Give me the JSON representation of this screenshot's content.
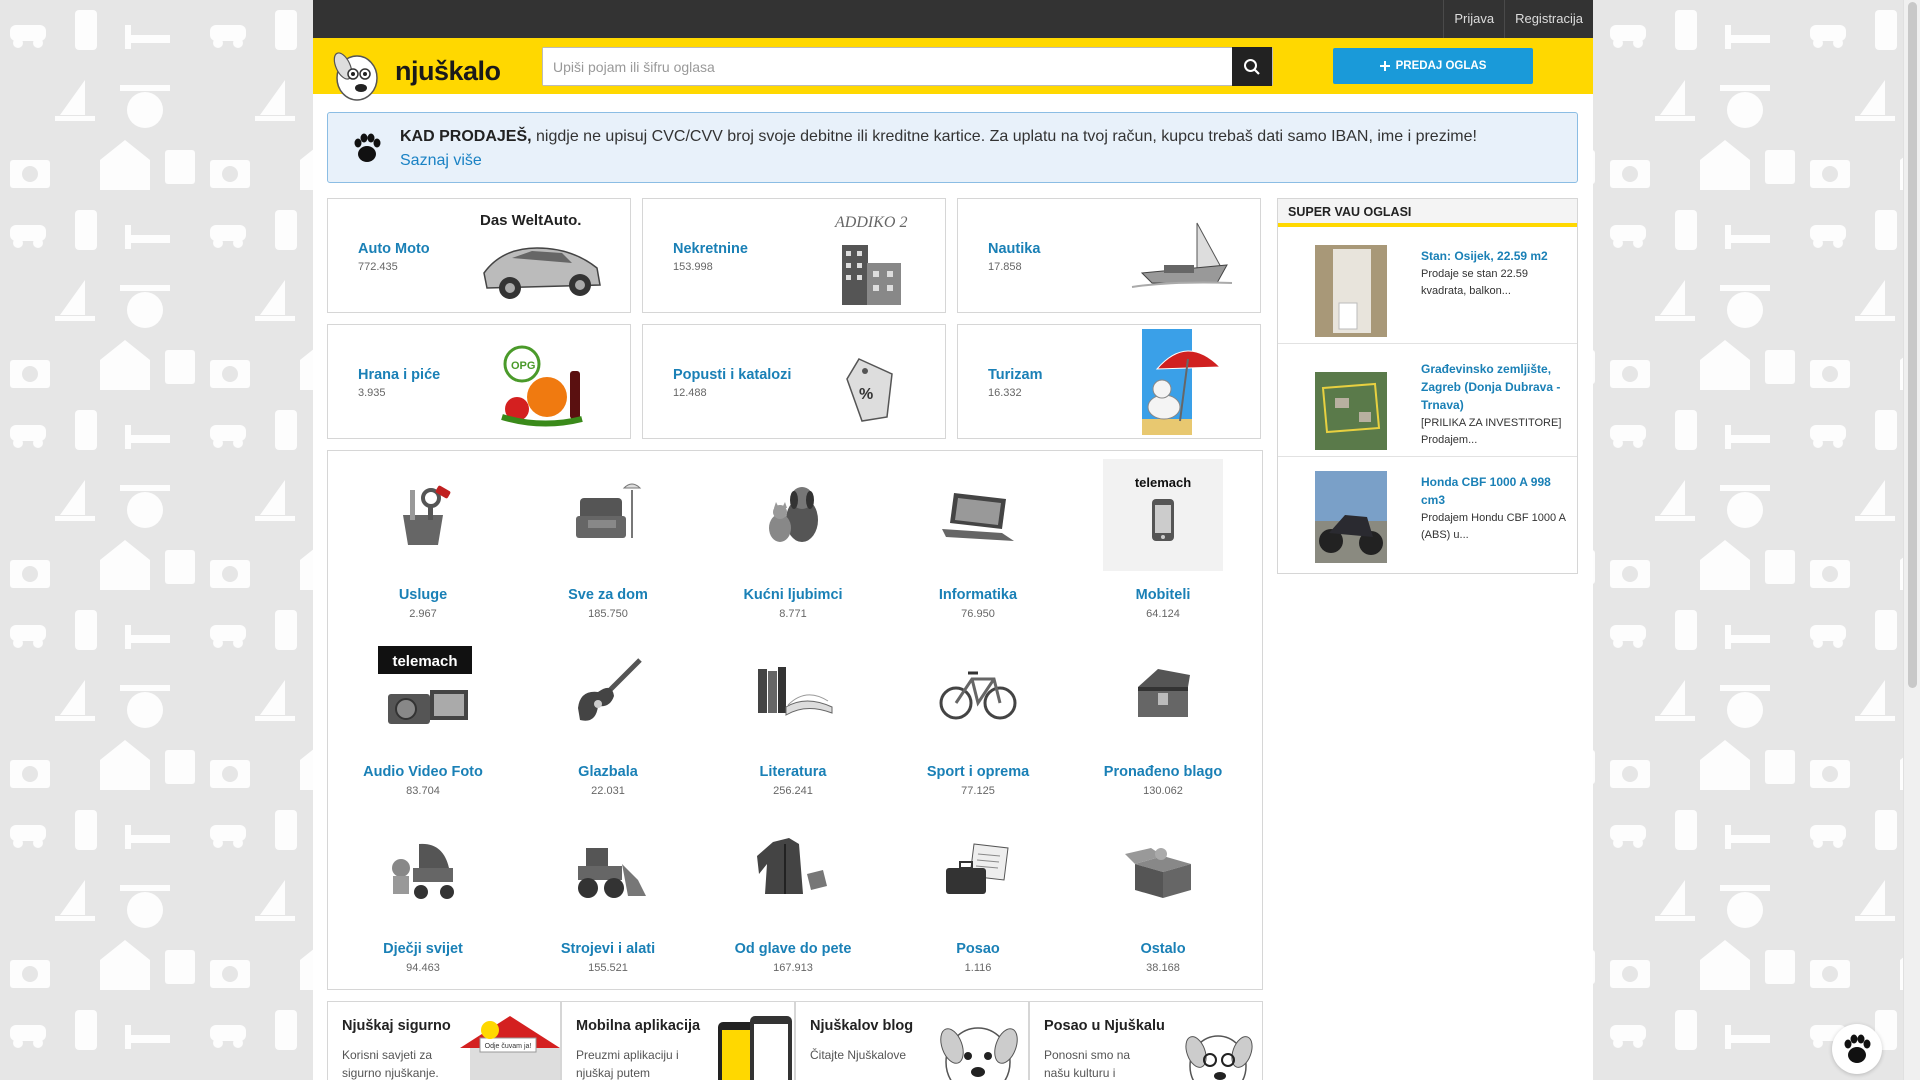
{
  "topbar": {
    "login": "Prijava",
    "register": "Registracija"
  },
  "brand": {
    "name": "njuškalo",
    "accent": "#ffd800",
    "link": "#1a80b6",
    "button": "#1a9ad9"
  },
  "search": {
    "placeholder": "Upiši pojam ili šifru oglasa",
    "value": ""
  },
  "sell_button": {
    "label": "PREDAJ OGLAS",
    "icon": "plus-icon"
  },
  "notice": {
    "bold": "KAD PRODAJEŠ,",
    "text": " nigdje ne upisuj CVC/CVV broj svoje debitne ili kreditne kartice. Za uplatu na tvoj račun, kupcu trebaš dati samo IBAN, ime i prezime!",
    "link": "Saznaj više",
    "icon": "paw-icon"
  },
  "top_categories": [
    {
      "label": "Auto Moto",
      "count": "772.435",
      "art_text": "Das WeltAuto."
    },
    {
      "label": "Nekretnine",
      "count": "153.998",
      "art_text": "ADDIKO 2"
    },
    {
      "label": "Nautika",
      "count": "17.858"
    },
    {
      "label": "Hrana i piće",
      "count": "3.935",
      "art_text": "OPG"
    },
    {
      "label": "Popusti i katalozi",
      "count": "12.488",
      "art_text": "%"
    },
    {
      "label": "Turizam",
      "count": "16.332"
    }
  ],
  "categories": [
    {
      "label": "Usluge",
      "count": "2.967",
      "icon": "tools-icon"
    },
    {
      "label": "Sve za dom",
      "count": "185.750",
      "icon": "armchair-icon"
    },
    {
      "label": "Kućni ljubimci",
      "count": "8.771",
      "icon": "pets-icon"
    },
    {
      "label": "Informatika",
      "count": "76.950",
      "icon": "laptop-icon"
    },
    {
      "label": "Mobiteli",
      "count": "64.124",
      "icon": "phone-icon",
      "sponsor": "telemach"
    },
    {
      "label": "Audio Video Foto",
      "count": "83.704",
      "icon": "camera-icon",
      "sponsor": "telemach"
    },
    {
      "label": "Glazbala",
      "count": "22.031",
      "icon": "guitar-icon"
    },
    {
      "label": "Literatura",
      "count": "256.241",
      "icon": "books-icon"
    },
    {
      "label": "Sport i oprema",
      "count": "77.125",
      "icon": "bicycle-icon"
    },
    {
      "label": "Pronađeno blago",
      "count": "130.062",
      "icon": "treasure-chest-icon"
    },
    {
      "label": "Dječji svijet",
      "count": "94.463",
      "icon": "stroller-icon"
    },
    {
      "label": "Strojevi i alati",
      "count": "155.521",
      "icon": "bulldozer-icon"
    },
    {
      "label": "Od glave do pete",
      "count": "167.913",
      "icon": "jacket-icon"
    },
    {
      "label": "Posao",
      "count": "1.116",
      "icon": "briefcase-icon"
    },
    {
      "label": "Ostalo",
      "count": "38.168",
      "icon": "box-icon"
    }
  ],
  "sidebar": {
    "title": "SUPER VAU OGLASI",
    "items": [
      {
        "title": "Stan: Osijek, 22.59 m2",
        "desc": "Prodaje se stan 22.59 kvadrata, balkon..."
      },
      {
        "title": "Građevinsko zemljište, Zagreb (Donja Dubrava - Trnava)",
        "desc": "[PRILIKA ZA INVESTITORE] Prodajem..."
      },
      {
        "title": "Honda CBF 1000 A 998 cm3",
        "desc": "Prodajem Hondu CBF 1000 A (ABS) u..."
      }
    ]
  },
  "footer_tiles": [
    {
      "title": "Njuškaj sigurno",
      "text": "Korisni savjeti za sigurno njuškanje.",
      "art_text": "Odje čuvam ja!"
    },
    {
      "title": "Mobilna aplikacija",
      "text": "Preuzmi aplikaciju i njuškaj putem"
    },
    {
      "title": "Njuškalov blog",
      "text": "Čitajte Njuškalove"
    },
    {
      "title": "Posao u Njuškalu",
      "text": "Ponosni smo na našu kulturu i"
    }
  ]
}
